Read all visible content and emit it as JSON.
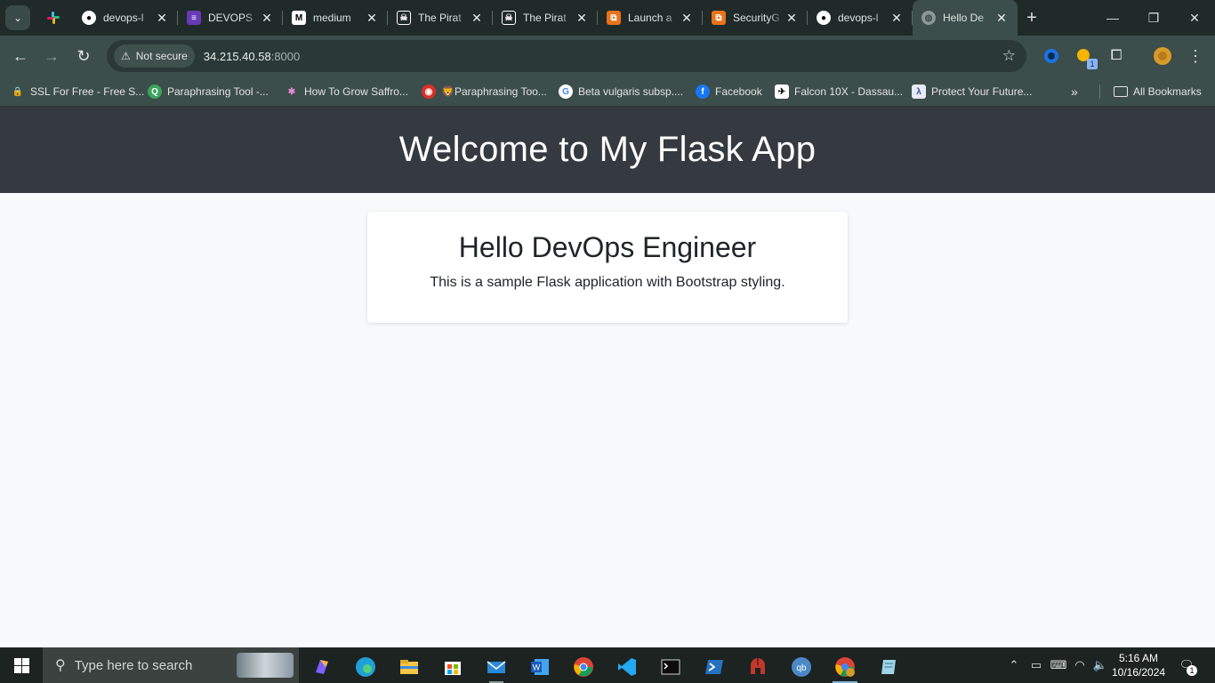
{
  "browser": {
    "tabs": [
      {
        "title": "devops-l",
        "icon": "github-icon"
      },
      {
        "title": "DEVOPS",
        "icon": "form-icon"
      },
      {
        "title": "medium",
        "icon": "medium-icon"
      },
      {
        "title": "The Pirat",
        "icon": "pirate-icon"
      },
      {
        "title": "The Pirat",
        "icon": "pirate-icon"
      },
      {
        "title": "Launch a",
        "icon": "aws-icon"
      },
      {
        "title": "SecurityG",
        "icon": "aws-icon"
      },
      {
        "title": "devops-l",
        "icon": "github-icon"
      },
      {
        "title": "Hello De",
        "icon": "globe-icon",
        "active": true
      }
    ],
    "security_label": "Not secure",
    "url_host": "34.215.40.58",
    "url_port": ":8000",
    "extension_badge": "1",
    "bookmarks": [
      {
        "label": "SSL For Free - Free S...",
        "icon": "lock-icon"
      },
      {
        "label": "Paraphrasing Tool -...",
        "icon": "paraphrase-icon"
      },
      {
        "label": "How To Grow Saffro...",
        "icon": "flower-icon"
      },
      {
        "label": "🦁Paraphrasing Too...",
        "icon": "red-badge-icon"
      },
      {
        "label": "Beta vulgaris subsp....",
        "icon": "google-icon"
      },
      {
        "label": "Facebook",
        "icon": "facebook-icon"
      },
      {
        "label": "Falcon 10X - Dassau...",
        "icon": "plane-icon"
      },
      {
        "label": "Protect Your Future...",
        "icon": "shield-doc-icon"
      }
    ],
    "all_bookmarks_label": "All Bookmarks"
  },
  "page": {
    "hero_title": "Welcome to My Flask App",
    "card_title": "Hello DevOps Engineer",
    "card_text": "This is a sample Flask application with Bootstrap styling."
  },
  "taskbar": {
    "search_placeholder": "Type here to search",
    "time": "5:16 AM",
    "date": "10/16/2024",
    "notification_count": "1"
  },
  "colors": {
    "hero_bg": "#343a40",
    "page_bg": "#f8f9fa",
    "browser_frame": "#3c4e4b",
    "tab_strip": "#1f2a29"
  }
}
